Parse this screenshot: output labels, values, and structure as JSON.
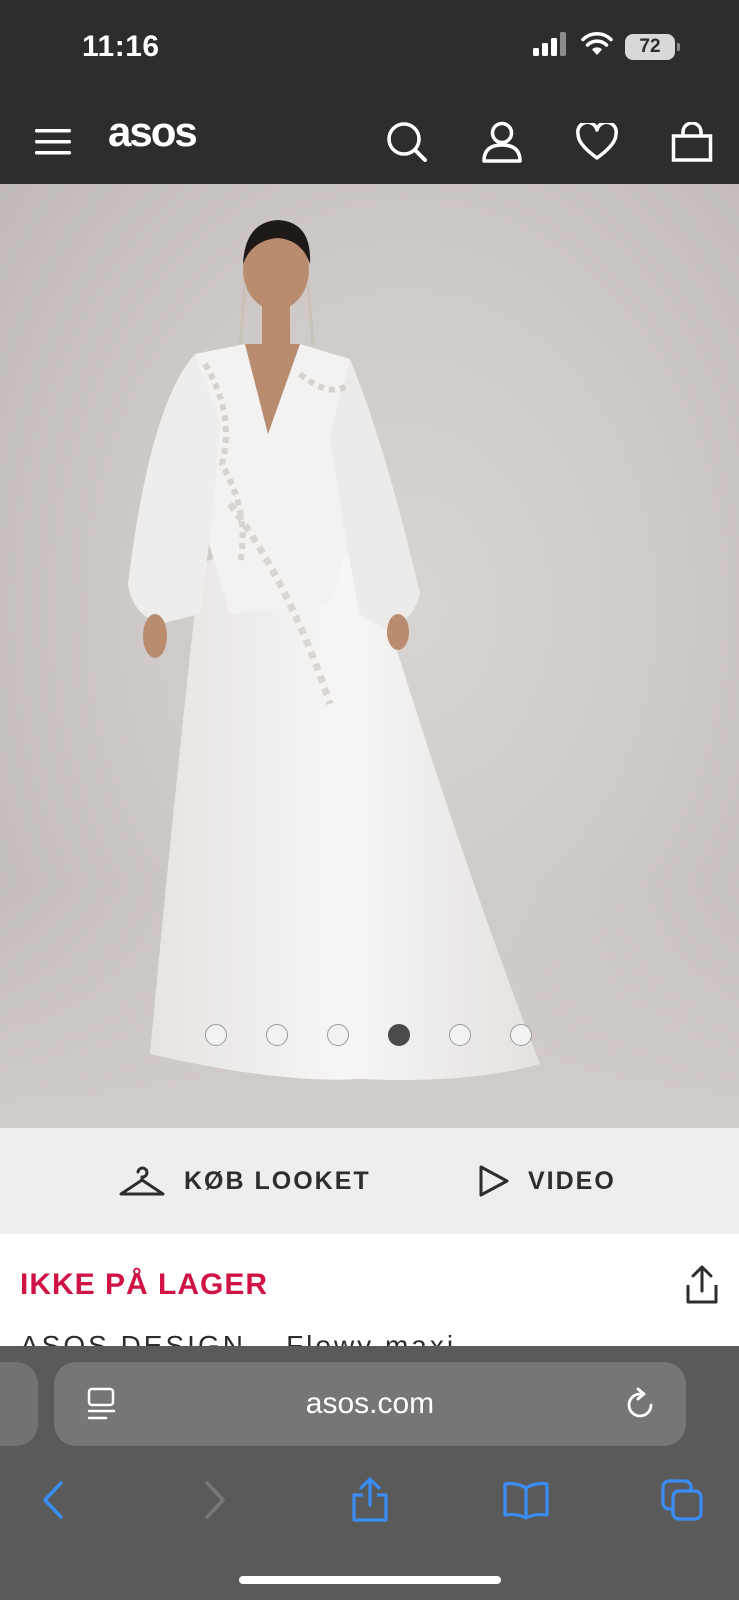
{
  "status_bar": {
    "time": "11:16",
    "battery": "72"
  },
  "header": {
    "logo": "asos"
  },
  "carousel": {
    "total_images": 6,
    "active_index": 3
  },
  "actions": {
    "shop_look": "KØB LOOKET",
    "video": "VIDEO"
  },
  "product": {
    "stock_status": "IKKE PÅ LAGER",
    "title_peek": "ASOS DESIGN – Flowy maxi ..."
  },
  "browser": {
    "url": "asos.com"
  },
  "colors": {
    "header_bg": "#2d2d2d",
    "stock_red": "#d01345",
    "safari_blue": "#3a8df5",
    "strip_bg": "#eeeeee"
  }
}
